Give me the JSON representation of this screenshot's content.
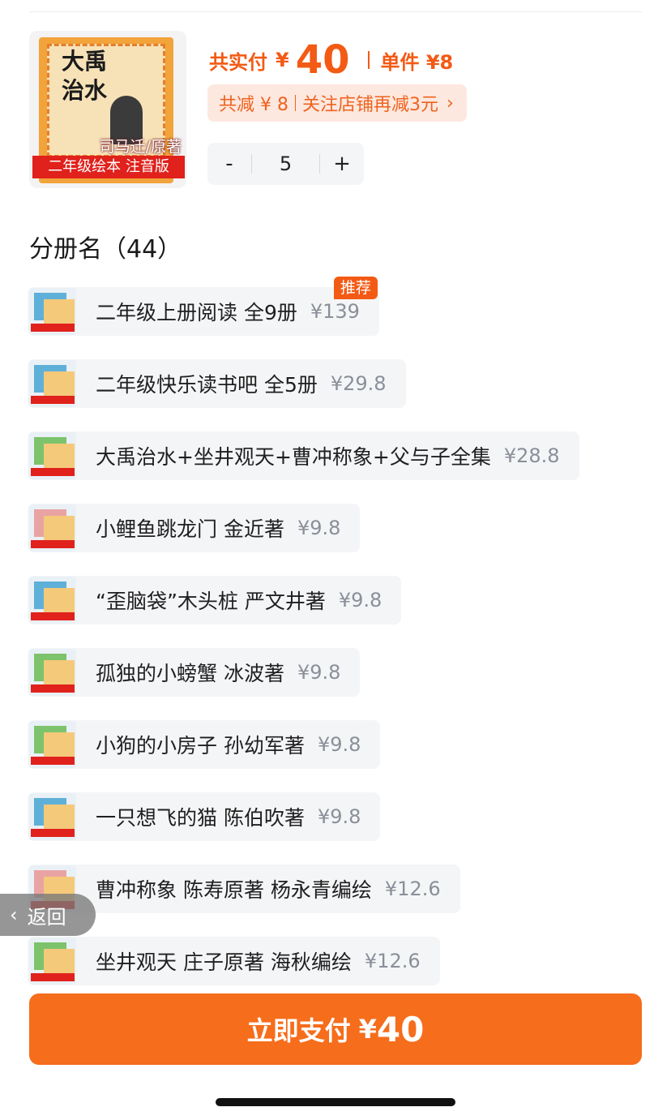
{
  "product": {
    "cover_title_line1": "大禹",
    "cover_title_line2": "治水",
    "cover_author": "司马迁/原著",
    "cover_banner": "二年级绘本 注音版",
    "total_label": "共实付",
    "currency": "¥",
    "total_amount": "40",
    "unit_price": "单件 ¥8",
    "discount_total": "共减 ¥ 8",
    "discount_follow": "关注店铺再减3元",
    "quantity": "5",
    "minus_label": "-",
    "plus_label": "+"
  },
  "section": {
    "title": "分册名（44）"
  },
  "variants": [
    {
      "name": "二年级上册阅读 全9册",
      "price": "¥139",
      "badge": "推荐"
    },
    {
      "name": "二年级快乐读书吧 全5册",
      "price": "¥29.8"
    },
    {
      "name": "大禹治水+坐井观天+曹冲称象+父与子全集",
      "price": "¥28.8"
    },
    {
      "name": "小鲤鱼跳龙门 金近著",
      "price": "¥9.8"
    },
    {
      "name": "“歪脑袋”木头桩 严文井著",
      "price": "¥9.8"
    },
    {
      "name": "孤独的小螃蟹 冰波著",
      "price": "¥9.8"
    },
    {
      "name": "小狗的小房子 孙幼军著",
      "price": "¥9.8"
    },
    {
      "name": "一只想飞的猫 陈伯吹著",
      "price": "¥9.8"
    },
    {
      "name": "曹冲称象 陈寿原著 杨永青编绘",
      "price": "¥12.6"
    },
    {
      "name": "坐井观天 庄子原著 海秋编绘",
      "price": "¥12.6"
    }
  ],
  "back_button": {
    "label": "返回"
  },
  "pay_button": {
    "label": "立即支付",
    "currency": "¥",
    "amount": "40"
  }
}
